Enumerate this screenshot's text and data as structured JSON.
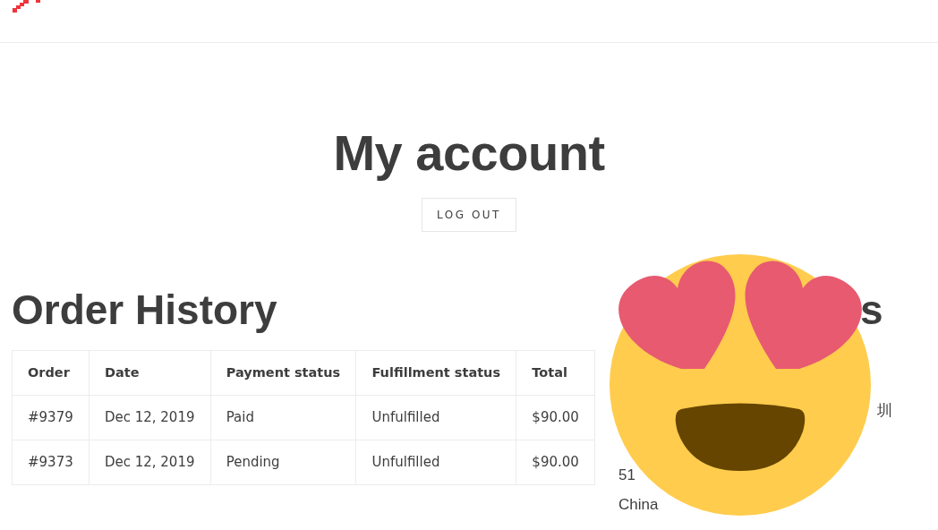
{
  "page": {
    "title": "My account",
    "logout_button": "LOG OUT"
  },
  "order_history": {
    "title": "Order History",
    "table": {
      "columns": [
        "Order",
        "Date",
        "Payment status",
        "Fulfillment status",
        "Total"
      ],
      "rows": [
        [
          "#9379",
          "Dec 12, 2019",
          "Paid",
          "Unfulfilled",
          "$90.00"
        ],
        [
          "#9373",
          "Dec 12, 2019",
          "Pending",
          "Unfulfilled",
          "$90.00"
        ]
      ]
    }
  },
  "account_details": {
    "title_fragment": "s",
    "address_lines": [
      "圳",
      "51",
      "China"
    ]
  }
}
